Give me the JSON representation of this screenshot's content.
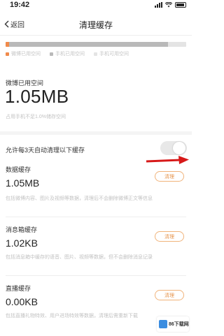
{
  "status_bar": {
    "time": "19:42"
  },
  "nav": {
    "back_label": "返回",
    "title": "清理缓存"
  },
  "storage_usage": {
    "weibo_fraction": 0.02,
    "phone_used_fraction": 0.88,
    "colors": {
      "weibo": "#f08a4b",
      "phone_used": "#b9b9b9",
      "phone_free": "#e4e4e4"
    },
    "legend": [
      "微博已用空间",
      "手机已用空间",
      "手机可用空间"
    ]
  },
  "weibo_usage": {
    "label": "微博已用空间",
    "value": "1.05MB",
    "hint": "占用手机不足1.0%储存空间"
  },
  "auto_clean": {
    "label": "允许每3天自动清理以下缓存",
    "enabled": false
  },
  "caches": [
    {
      "title": "数据缓存",
      "size": "1.05MB",
      "button": "清理",
      "desc": "包括微博内容、图片及视频等数据，清理后不会删除微博正文等信息"
    },
    {
      "title": "消息箱缓存",
      "size": "1.02KB",
      "button": "清理",
      "desc": "包括消息箱中缓存的语音、图片、视频等数据，但不会删除消息记录"
    },
    {
      "title": "直播缓存",
      "size": "0.00KB",
      "button": "清理",
      "desc": "包括直播礼物特效、用户进场特效等数据，清理后需重新下载"
    }
  ],
  "watermark": {
    "text": "86下载网"
  }
}
